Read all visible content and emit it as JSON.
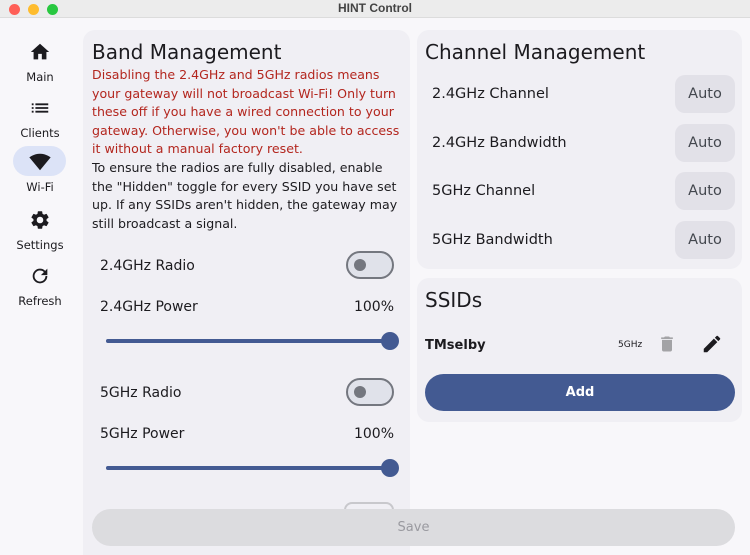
{
  "window": {
    "title": "HINT Control"
  },
  "nav": {
    "items": [
      {
        "label": "Main",
        "icon": "home-icon"
      },
      {
        "label": "Clients",
        "icon": "list-icon"
      },
      {
        "label": "Wi-Fi",
        "icon": "wifi-icon",
        "active": true
      },
      {
        "label": "Settings",
        "icon": "gear-icon"
      },
      {
        "label": "Refresh",
        "icon": "refresh-icon"
      }
    ]
  },
  "band": {
    "title": "Band Management",
    "warning": "Disabling the 2.4GHz and 5GHz radios means your gateway will not broadcast Wi-Fi! Only turn these off if you have a wired connection to your gateway. Otherwise, you won't be able to access it without a manual factory reset.",
    "info": "To ensure the radios are fully disabled, enable the \"Hidden\" toggle for every SSID you have set up. If any SSIDs aren't hidden, the gateway may still broadcast a signal.",
    "radio24_label": "2.4GHz Radio",
    "radio24_on": false,
    "power24_label": "2.4GHz Power",
    "power24_value": "100%",
    "power24_level": 1.0,
    "radio5_label": "5GHz Radio",
    "radio5_on": false,
    "power5_label": "5GHz Power",
    "power5_value": "100%",
    "power5_level": 1.0
  },
  "channel": {
    "title": "Channel Management",
    "rows": [
      {
        "label": "2.4GHz Channel",
        "value": "Auto"
      },
      {
        "label": "2.4GHz Bandwidth",
        "value": "Auto"
      },
      {
        "label": "5GHz Channel",
        "value": "Auto"
      },
      {
        "label": "5GHz Bandwidth",
        "value": "Auto"
      }
    ]
  },
  "ssids": {
    "title": "SSIDs",
    "items": [
      {
        "name": "TMselby",
        "band": "5GHz"
      }
    ],
    "add_label": "Add"
  },
  "footer": {
    "save_label": "Save"
  },
  "colors": {
    "accent": "#435a92",
    "warning": "#b3261e",
    "active_nav": "#dce3f7",
    "card": "#f0eff4"
  }
}
